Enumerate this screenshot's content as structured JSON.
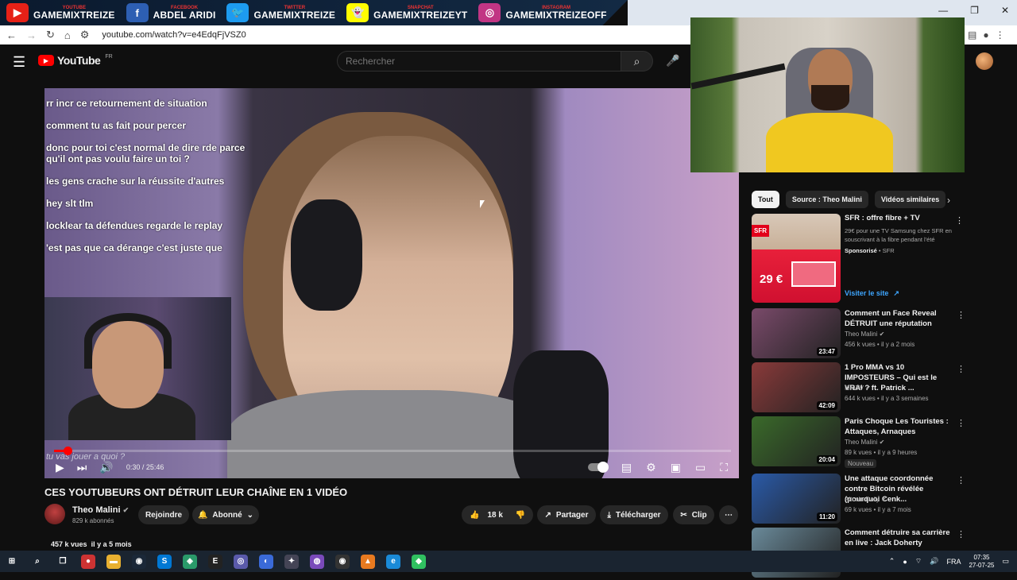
{
  "banner": {
    "items": [
      {
        "platform": "YOUTUBE",
        "handle": "GAMEMIXTREIZE",
        "color": "#e62117",
        "glyph": "▶"
      },
      {
        "platform": "FACEBOOK",
        "handle": "ABDEL ARIDI",
        "color": "#2d5fb3",
        "glyph": "f"
      },
      {
        "platform": "TWITTER",
        "handle": "GAMEMIXTREIZE",
        "color": "#1d9bf0",
        "glyph": "🐦"
      },
      {
        "platform": "SNAPCHAT",
        "handle": "GAMEMIXTREIZEYT",
        "color": "#fffc00",
        "glyph": "👻"
      },
      {
        "platform": "INSTAGRAM",
        "handle": "GAMEMIXTREIZEOFF",
        "color": "#c13584",
        "glyph": "◎"
      }
    ]
  },
  "browser": {
    "url": "youtube.com/watch?v=e4EdqFjVSZ0"
  },
  "header": {
    "logo_text": "YouTube",
    "region": "FR",
    "search_placeholder": "Rechercher"
  },
  "player": {
    "chat": [
      {
        "user": "",
        "text": "rr incr ce retournement de situation"
      },
      {
        "user": "",
        "text": "comment tu as fait pour percer"
      },
      {
        "user": "",
        "text": "donc pour toi c'est normal de dire rde parce qu'il ont pas voulu faire un toi ?"
      },
      {
        "user": "",
        "text": "les gens crache sur la réussite d'autres"
      },
      {
        "user": "",
        "text": "hey slt tlm"
      },
      {
        "user": "",
        "text": "locklear ta défendues regarde le replay"
      },
      {
        "user": "",
        "text": "'est pas que ca dérange c'est juste que"
      }
    ],
    "subtitle_line": "tu vas jouer a quoi ?",
    "time": "0:30 / 25:46",
    "progress": 0.02
  },
  "video": {
    "title": "CES YOUTUBEURS ONT DÉTRUIT LEUR CHAÎNE EN 1 VIDÉO",
    "channel": "Theo Malini",
    "subscribers": "829 k abonnés",
    "join_label": "Rejoindre",
    "subscribed_label": "Abonné",
    "likes": "18 k",
    "share_label": "Partager",
    "download_label": "Télécharger",
    "clip_label": "Clip",
    "views": "457 k vues",
    "age": "il y a 5 mois"
  },
  "sidebar": {
    "chips": [
      "Tout",
      "Source : Theo Malini",
      "Vidéos similaires"
    ],
    "ad": {
      "title": "SFR : offre fibre + TV",
      "description": "29€ pour une TV Samsung chez SFR en souscrivant à la fibre pendant l'été",
      "sponsored": "Sponsorisé",
      "advertiser": "SFR",
      "brand": "SFR",
      "price": "29 €",
      "visit_label": "Visiter le site"
    },
    "videos": [
      {
        "title": "Comment un Face Reveal DÉTRUIT une réputation",
        "channel": "Theo Malini",
        "views": "456 k vues",
        "age": "il y a 2 mois",
        "duration": "23:47",
        "badge": "",
        "thumb": "#7a4a6a"
      },
      {
        "title": "1 Pro MMA vs 10 IMPOSTEURS – Qui est le VRAI ? ft. Patrick ...",
        "channel": "IbraTV",
        "views": "644 k vues",
        "age": "il y a 3 semaines",
        "duration": "42:09",
        "badge": "",
        "thumb": "#8a3a3a"
      },
      {
        "title": "Paris Choque Les Touristes : Attaques, Arnaques",
        "channel": "Theo Malini",
        "views": "89 k vues",
        "age": "il y a 9 heures",
        "duration": "20:04",
        "badge": "Nouveau",
        "thumb": "#3a6a2a"
      },
      {
        "title": "Une attaque coordonnée contre Bitcoin révélée (pourquoi Cenk...",
        "channel": "Altcoin Daily",
        "views": "69 k vues",
        "age": "il y a 7 mois",
        "duration": "11:20",
        "badge": "",
        "thumb": "#2a5aa8"
      },
      {
        "title": "Comment détruire sa carrière en live : Jack Doherty",
        "channel": "",
        "views": "",
        "age": "",
        "duration": "",
        "badge": "",
        "thumb": "#6a8a9a"
      }
    ]
  },
  "taskbar": {
    "lang": "FRA",
    "time": "07:35",
    "date": "27-07-25"
  }
}
